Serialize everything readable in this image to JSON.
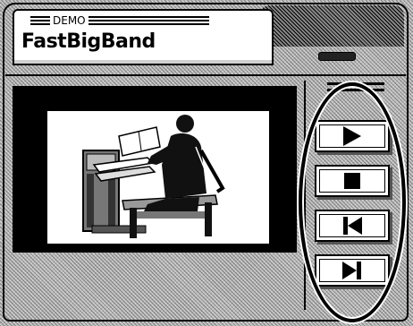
{
  "header": {
    "mode_label": "DEMO",
    "song_title": "FastBigBand"
  },
  "screen": {
    "image_icon": "organist-at-organ-illustration"
  },
  "transport": {
    "buttons": [
      {
        "name": "play",
        "icon": "play-icon"
      },
      {
        "name": "stop",
        "icon": "stop-icon"
      },
      {
        "name": "previous",
        "icon": "previous-track-icon"
      },
      {
        "name": "next",
        "icon": "next-track-icon"
      }
    ]
  },
  "colors": {
    "lcd_background": "#ffffff",
    "frame": "#000000",
    "panel_texture": "#bdbdbd",
    "highlight_ring": "#000000"
  }
}
